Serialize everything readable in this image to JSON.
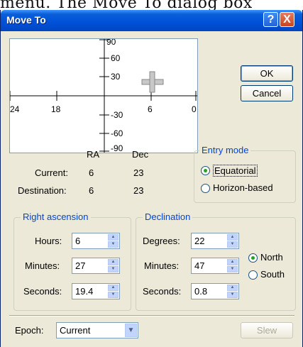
{
  "page_text": "menu. The Move To dialog box",
  "window": {
    "title": "Move To",
    "help_label": "?",
    "close_label": "X"
  },
  "buttons": {
    "ok": "OK",
    "cancel": "Cancel",
    "slew": "Slew"
  },
  "plot": {
    "ra_ticks": [
      "24",
      "18",
      "6",
      "0"
    ],
    "dec_ticks": [
      "90",
      "60",
      "30",
      "-30",
      "-60",
      "-90"
    ]
  },
  "coords": {
    "col_ra": "RA",
    "col_dec": "Dec",
    "current_label": "Current:",
    "current_ra": "6",
    "current_dec": "23",
    "destination_label": "Destination:",
    "destination_ra": "6",
    "destination_dec": "23"
  },
  "entry_mode": {
    "title": "Entry mode",
    "equatorial": "Equatorial",
    "horizon": "Horizon-based",
    "selected": "Equatorial"
  },
  "right_ascension": {
    "title": "Right ascension",
    "hours_label": "Hours:",
    "hours": "6",
    "minutes_label": "Minutes:",
    "minutes": "27",
    "seconds_label": "Seconds:",
    "seconds": "19.4"
  },
  "declination": {
    "title": "Declination",
    "degrees_label": "Degrees:",
    "degrees": "22",
    "minutes_label": "Minutes:",
    "minutes": "47",
    "seconds_label": "Seconds:",
    "seconds": "0.8",
    "north": "North",
    "south": "South",
    "selected": "North"
  },
  "epoch": {
    "label": "Epoch:",
    "value": "Current"
  },
  "icons": {
    "spin_up": "▲",
    "spin_down": "▼",
    "dropdown": "▼"
  }
}
